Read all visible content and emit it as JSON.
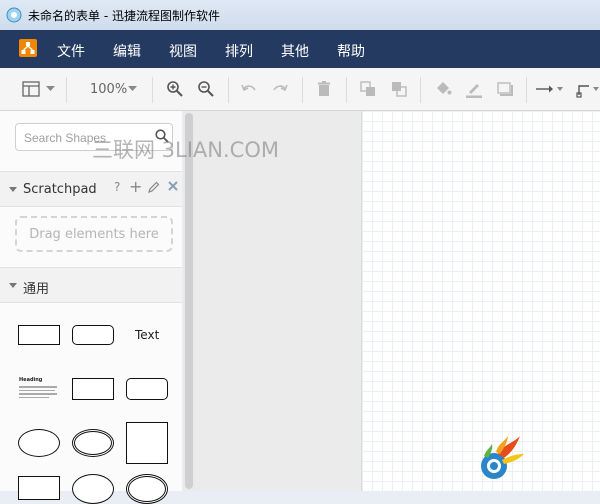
{
  "window": {
    "title": "未命名的表单 - 迅捷流程图制作软件"
  },
  "menu": {
    "items": [
      "文件",
      "编辑",
      "视图",
      "排列",
      "其他",
      "帮助"
    ]
  },
  "toolbar": {
    "zoom": "100%"
  },
  "sidebar": {
    "search_placeholder": "Search Shapes",
    "scratchpad": {
      "title": "Scratchpad",
      "help": "?",
      "add": "+",
      "drop_hint": "Drag elements here"
    },
    "general": {
      "title": "通用",
      "text_shape": "Text",
      "heading_title": "Heading"
    }
  },
  "watermark": "三联网 3LIAN.COM",
  "colors": {
    "menubar": "#243a60",
    "accent": "#f08705",
    "titlebar": "#dfe9f5"
  }
}
